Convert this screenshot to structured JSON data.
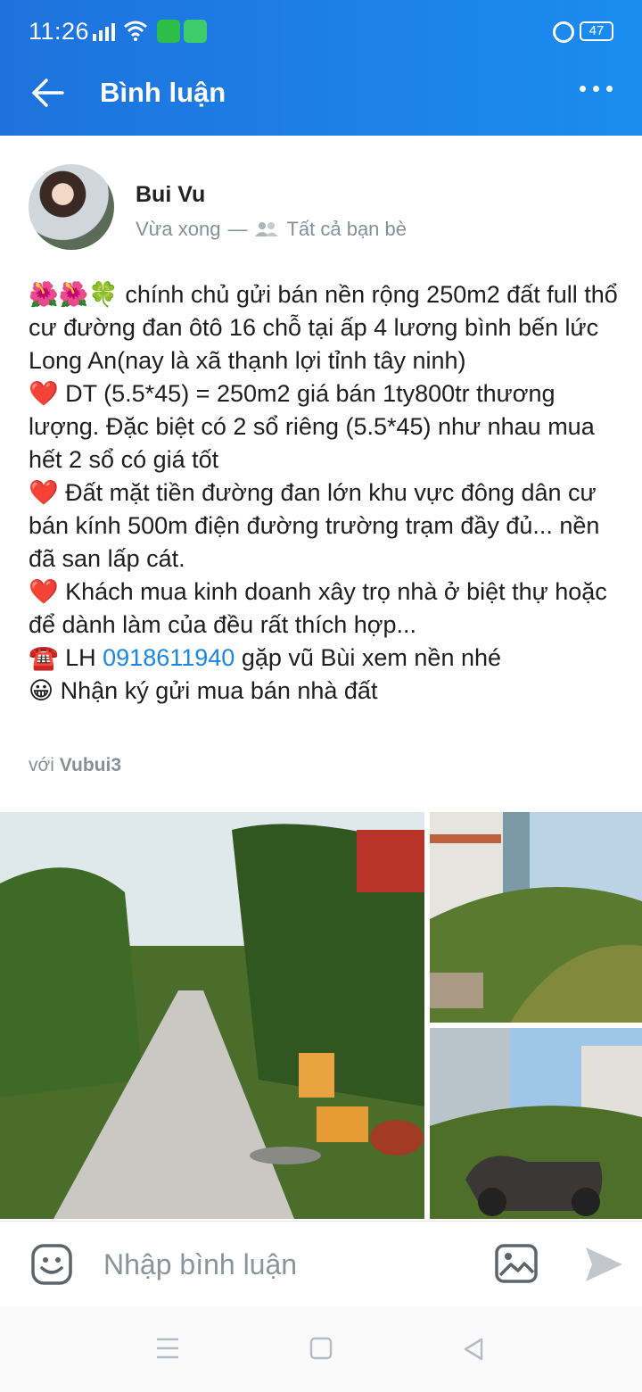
{
  "status_bar": {
    "time": "11:26",
    "battery": "47"
  },
  "app_bar": {
    "title": "Bình luận"
  },
  "post": {
    "author": "Bui Vu",
    "time": "Vừa xong",
    "separator": "—",
    "audience": "Tất cả bạn bè",
    "lines": [
      "🌺🌺🍀 chính chủ gửi bán nền rộng 250m2 đất full thổ cư đường đan ôtô 16 chỗ tại ấp 4 lương bình bến lức Long An(nay là xã thạnh lợi tỉnh tây ninh)",
      "❤️ DT (5.5*45) = 250m2 giá bán 1ty800tr thương lượng. Đặc biệt có 2 sổ riêng (5.5*45) như nhau mua hết 2 sổ có giá tốt",
      "❤️ Đất mặt tiền đường đan lớn khu vực đông dân cư bán kính 500m điện đường trường trạm đầy đủ... nền đã san lấp cát.",
      "❤️ Khách mua kinh doanh xây trọ nhà ở biệt thự hoặc để dành làm của đều rất thích hợp..."
    ],
    "contact_prefix": "☎️ LH ",
    "contact_phone": "0918611940",
    "contact_suffix": " gặp vũ Bùi xem nền nhé",
    "last_line": "😀 Nhận ký gửi mua bán nhà đất",
    "with_label": "với",
    "with_user": "Vubui3"
  },
  "composer": {
    "placeholder": "Nhập bình luận"
  },
  "icons": {
    "back": "arrow-left-icon",
    "more": "more-dots-icon",
    "audience": "friends-icon",
    "emoji": "emoji-icon",
    "image": "image-icon",
    "send": "send-icon"
  },
  "colors": {
    "accent": "#1a86e8",
    "appbar_start": "#1f72dd",
    "appbar_end": "#1a8cf0",
    "muted": "#8a8f96"
  }
}
